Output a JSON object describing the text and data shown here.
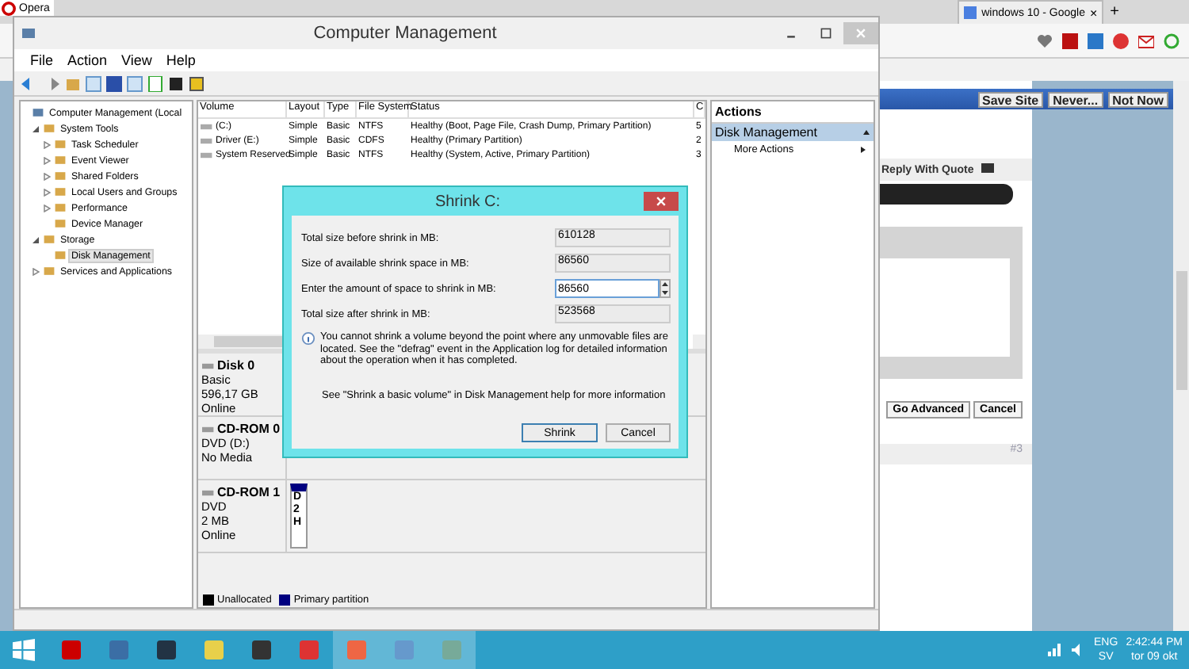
{
  "browser": {
    "opera_button": "Opera",
    "tab": {
      "title": "windows 10 - Google",
      "close": "×"
    },
    "new_tab": "+",
    "password_bar": {
      "buttons": [
        "Save Site",
        "Never...",
        "Not Now"
      ]
    },
    "reply": "Reply With Quote",
    "editor_buttons": [
      "Go Advanced",
      "Cancel"
    ],
    "post_number": "#3"
  },
  "window": {
    "title": "Computer Management",
    "menu": [
      "File",
      "Action",
      "View",
      "Help"
    ]
  },
  "tree": [
    {
      "label": "Computer Management (Local",
      "selected": false,
      "children": [
        {
          "label": "System Tools",
          "expanded": true,
          "selected": false,
          "children": [
            {
              "label": "Task Scheduler",
              "expanded": false,
              "selected": false
            },
            {
              "label": "Event Viewer",
              "expanded": false,
              "selected": false
            },
            {
              "label": "Shared Folders",
              "expanded": false,
              "selected": false
            },
            {
              "label": "Local Users and Groups",
              "expanded": false,
              "selected": false
            },
            {
              "label": "Performance",
              "expanded": false,
              "selected": false
            },
            {
              "label": "Device Manager",
              "selected": false
            }
          ]
        },
        {
          "label": "Storage",
          "expanded": true,
          "selected": false,
          "children": [
            {
              "label": "Disk Management",
              "selected": true
            }
          ]
        },
        {
          "label": "Services and Applications",
          "expanded": false,
          "selected": false
        }
      ]
    }
  ],
  "volumes": {
    "columns": [
      "Volume",
      "Layout",
      "Type",
      "File System",
      "Status",
      "C"
    ],
    "rows": [
      [
        "(C:)",
        "Simple",
        "Basic",
        "NTFS",
        "Healthy (Boot, Page File, Crash Dump, Primary Partition)",
        "5"
      ],
      [
        "Driver (E:)",
        "Simple",
        "Basic",
        "CDFS",
        "Healthy (Primary Partition)",
        "2"
      ],
      [
        "System Reserved",
        "Simple",
        "Basic",
        "NTFS",
        "Healthy (System, Active, Primary Partition)",
        "3"
      ]
    ]
  },
  "disks": [
    {
      "name": "Disk 0",
      "details": [
        "Basic",
        "596,17 GB",
        "Online"
      ]
    },
    {
      "name": "CD-ROM 0",
      "details": [
        "DVD (D:)",
        "No Media"
      ]
    },
    {
      "name": "CD-ROM 1",
      "details": [
        "DVD",
        "2 MB",
        "Online"
      ],
      "partition_lines": [
        "D",
        "2",
        "H"
      ]
    }
  ],
  "legend": [
    {
      "label": "Unallocated",
      "color": "#000000"
    },
    {
      "label": "Primary partition",
      "color": "#000080"
    }
  ],
  "actions": {
    "title": "Actions",
    "section": "Disk Management",
    "items": [
      "More Actions"
    ]
  },
  "dialog": {
    "title": "Shrink C:",
    "fields": [
      {
        "label": "Total size before shrink in MB:",
        "value": "610128",
        "kind": "readonly"
      },
      {
        "label": "Size of available shrink space in MB:",
        "value": "86560",
        "kind": "readonly"
      },
      {
        "label": "Enter the amount of space to shrink in MB:",
        "value": "86560",
        "kind": "spin"
      },
      {
        "label": "Total size after shrink in MB:",
        "value": "523568",
        "kind": "readonly"
      }
    ],
    "note": "You cannot shrink a volume beyond the point where any unmovable files are located. See the \"defrag\" event in the Application log for detailed information about the operation when it has completed.",
    "help": "See \"Shrink a basic volume\" in Disk Management help for more information",
    "buttons": [
      {
        "label": "Shrink",
        "default": true
      },
      {
        "label": "Cancel",
        "default": false
      }
    ]
  },
  "tray": {
    "language": "ENG",
    "layout": "SV",
    "time": "2:42:44 PM",
    "date": "tor 09 okt"
  }
}
